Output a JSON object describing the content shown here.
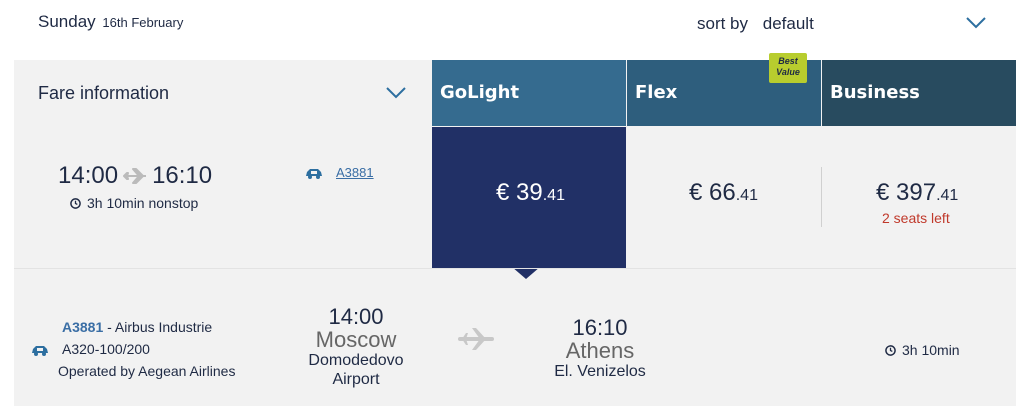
{
  "header": {
    "day": "Sunday",
    "date": "16th February",
    "sort_label": "sort by",
    "sort_value": "default"
  },
  "fare_table": {
    "fare_info_label": "Fare information",
    "columns": [
      {
        "name": "GoLight",
        "color": "#356b8f"
      },
      {
        "name": "Flex",
        "color": "#2e5e7d"
      },
      {
        "name": "Business",
        "color": "#284b5f"
      }
    ],
    "best_value_badge": "Best Value",
    "best_value_color": "#b8cd2e"
  },
  "flight": {
    "departure_time": "14:00",
    "arrival_time": "16:10",
    "duration": "3h 10min nonstop",
    "flight_number": "A3881",
    "prices": [
      {
        "currency": "€",
        "main": "39",
        "cents": ".41",
        "selected": true
      },
      {
        "currency": "€",
        "main": "66",
        "cents": ".41"
      },
      {
        "currency": "€",
        "main": "397",
        "cents": ".41",
        "note": "2 seats left"
      }
    ]
  },
  "details": {
    "flight_number": "A3881",
    "aircraft_line1": " - Airbus Industrie",
    "aircraft_line2": "A320-100/200",
    "operated_by": "Operated by Aegean Airlines",
    "from": {
      "time": "14:00",
      "city": "Moscow",
      "airport_line1": "Domodedovo",
      "airport_line2": "Airport"
    },
    "to": {
      "time": "16:10",
      "city": "Athens",
      "airport_line1": "El. Venizelos"
    },
    "duration": "3h 10min"
  },
  "icons": [
    "plane-icon",
    "clock-icon",
    "car-icon",
    "chevron-down-icon"
  ],
  "colors": {
    "selected_fare": "#213066",
    "link": "#3a6ea5",
    "warning": "#c0392b"
  }
}
